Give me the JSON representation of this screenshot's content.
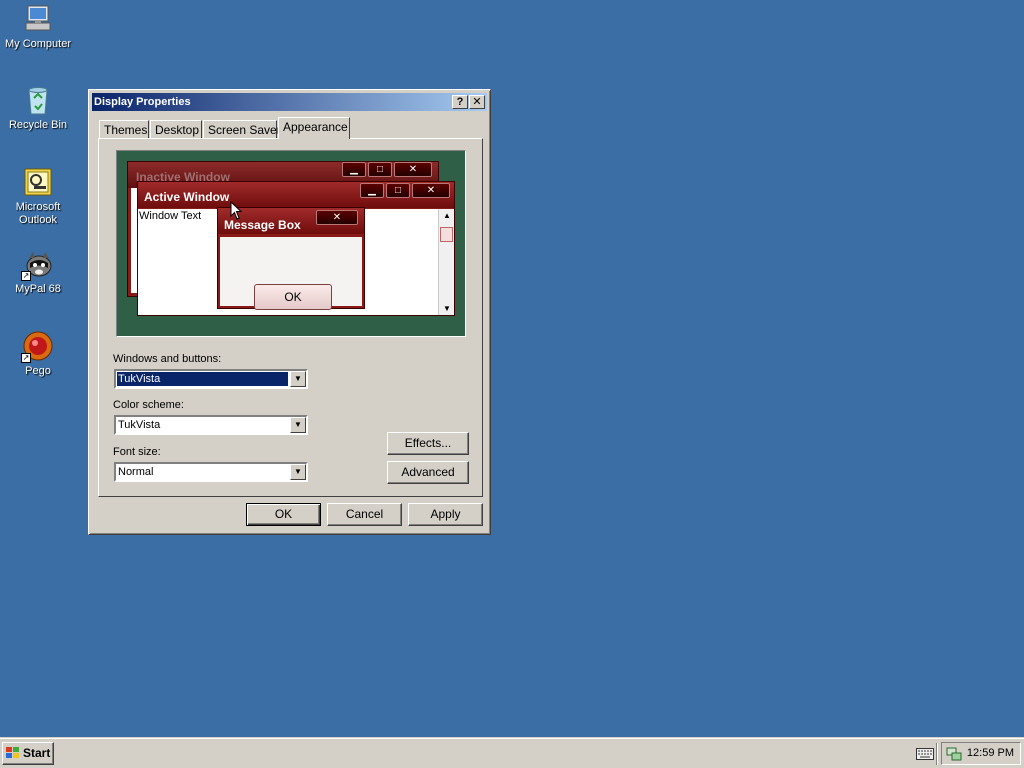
{
  "desktop": {
    "icons": [
      {
        "label": "My Computer",
        "icon": "my-computer-icon"
      },
      {
        "label": "Recycle Bin",
        "icon": "recycle-bin-icon"
      },
      {
        "label": "Microsoft Outlook",
        "icon": "outlook-icon"
      },
      {
        "label": "MyPal 68",
        "icon": "mypal-icon"
      },
      {
        "label": "Pego",
        "icon": "pego-icon"
      }
    ]
  },
  "dialog": {
    "title": "Display Properties",
    "help_button": "?",
    "close_button": "✕",
    "tabs": [
      {
        "label": "Themes"
      },
      {
        "label": "Desktop"
      },
      {
        "label": "Screen Saver"
      },
      {
        "label": "Appearance",
        "active": true
      }
    ],
    "preview": {
      "inactive_title": "Inactive Window",
      "active_title": "Active Window",
      "window_text": "Window Text",
      "message_title": "Message Box",
      "ok_label": "OK",
      "minimize": "▁",
      "maximize": "□",
      "close": "✕"
    },
    "fields": {
      "windows_buttons_label": "Windows and buttons:",
      "windows_buttons_value": "TukVista",
      "color_scheme_label": "Color scheme:",
      "color_scheme_value": "TukVista",
      "font_size_label": "Font size:",
      "font_size_value": "Normal"
    },
    "buttons": {
      "effects": "Effects...",
      "advanced": "Advanced",
      "ok": "OK",
      "cancel": "Cancel",
      "apply": "Apply"
    }
  },
  "taskbar": {
    "start_label": "Start",
    "clock": "12:59 PM"
  },
  "colors": {
    "desktop_background": "#3a6ea5",
    "title_active": "#0a246a",
    "scheme_red": "#8a1a1a"
  }
}
